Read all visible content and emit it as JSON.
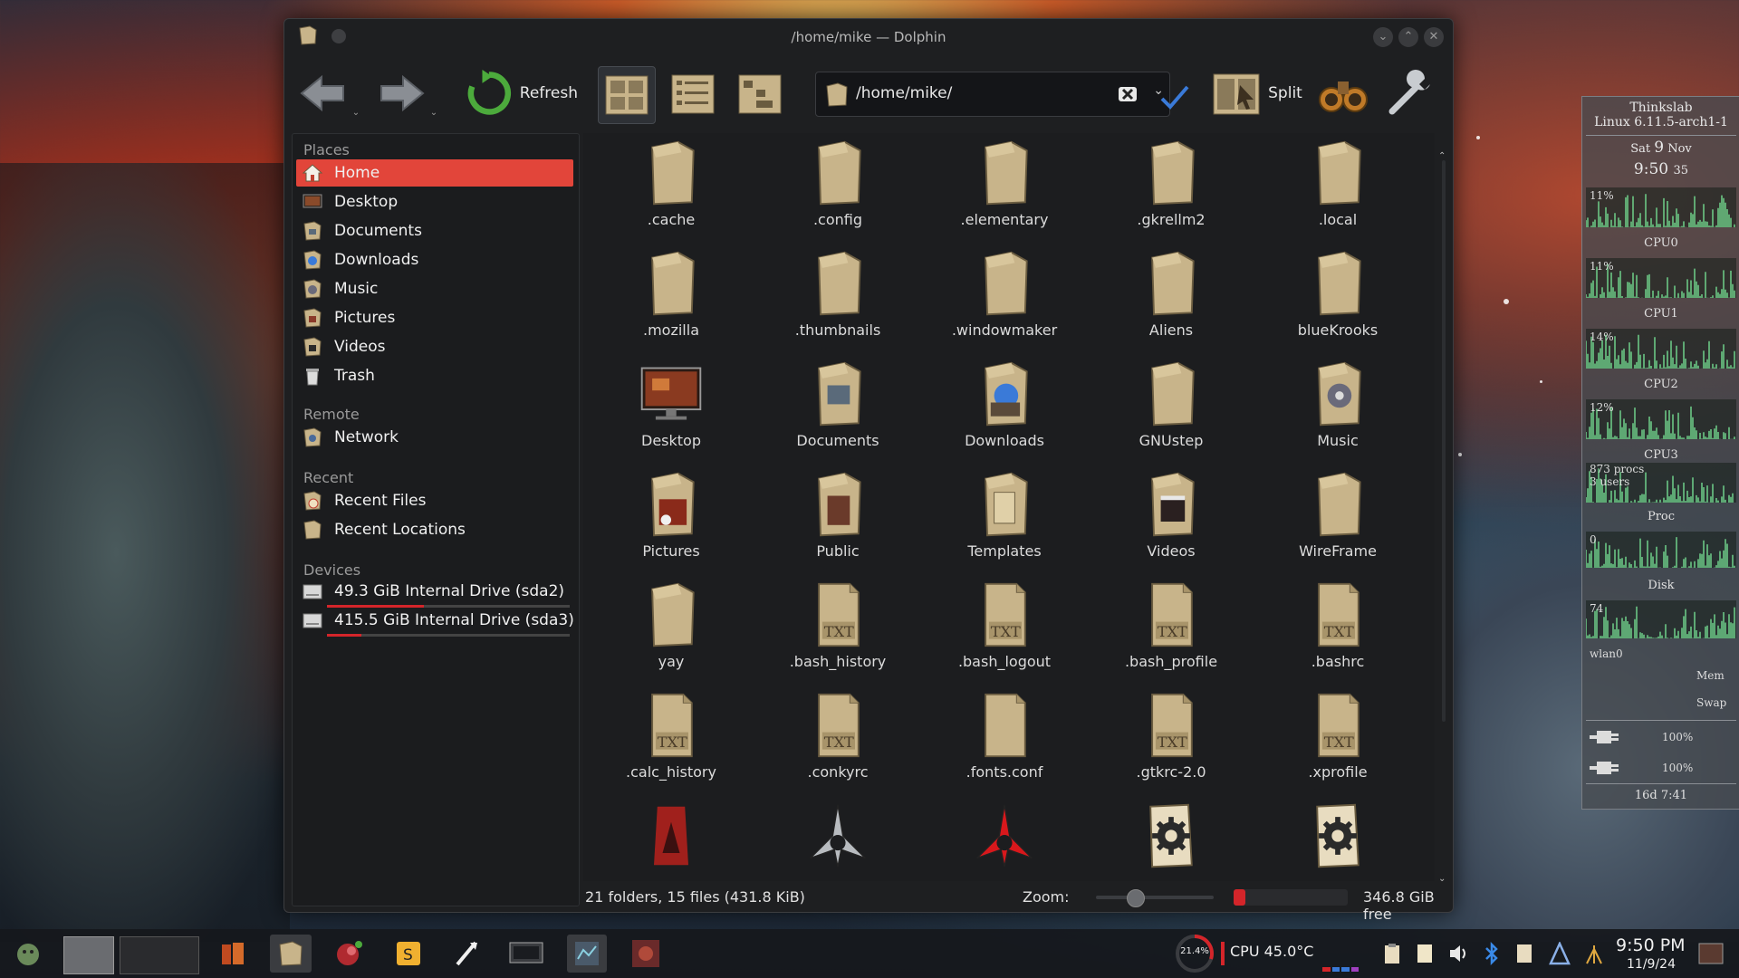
{
  "window": {
    "title": "/home/mike — Dolphin",
    "buttons": [
      "minimize",
      "maximize",
      "close"
    ]
  },
  "toolbar": {
    "refresh_label": "Refresh",
    "split_label": "Split",
    "location_path": "/home/mike/"
  },
  "places": {
    "places_title": "Places",
    "remote_title": "Remote",
    "recent_title": "Recent",
    "devices_title": "Devices",
    "items": {
      "home": "Home",
      "desktop": "Desktop",
      "documents": "Documents",
      "downloads": "Downloads",
      "music": "Music",
      "pictures": "Pictures",
      "videos": "Videos",
      "trash": "Trash",
      "network": "Network",
      "recent_files": "Recent Files",
      "recent_locations": "Recent Locations",
      "drive_sda2": "49.3 GiB Internal Drive (sda2)",
      "drive_sda3": "415.5 GiB Internal Drive (sda3)"
    },
    "drive_sda2_used": 0.4,
    "drive_sda3_used": 0.14
  },
  "files": [
    {
      "name": ".cache",
      "icon": "folder-icon"
    },
    {
      "name": ".config",
      "icon": "folder-icon"
    },
    {
      "name": ".elementary",
      "icon": "folder-icon"
    },
    {
      "name": ".gkrellm2",
      "icon": "folder-icon"
    },
    {
      "name": ".local",
      "icon": "folder-icon"
    },
    {
      "name": ".mozilla",
      "icon": "folder-icon"
    },
    {
      "name": ".thumbnails",
      "icon": "folder-icon"
    },
    {
      "name": ".windowmaker",
      "icon": "folder-icon"
    },
    {
      "name": "Aliens",
      "icon": "folder-icon"
    },
    {
      "name": "blueKrooks",
      "icon": "folder-icon"
    },
    {
      "name": "Desktop",
      "icon": "desktop-folder-icon"
    },
    {
      "name": "Documents",
      "icon": "documents-folder-icon"
    },
    {
      "name": "Downloads",
      "icon": "downloads-folder-icon"
    },
    {
      "name": "GNUstep",
      "icon": "folder-icon"
    },
    {
      "name": "Music",
      "icon": "music-folder-icon"
    },
    {
      "name": "Pictures",
      "icon": "pictures-folder-icon"
    },
    {
      "name": "Public",
      "icon": "public-folder-icon"
    },
    {
      "name": "Templates",
      "icon": "templates-folder-icon"
    },
    {
      "name": "Videos",
      "icon": "videos-folder-icon"
    },
    {
      "name": "WireFrame",
      "icon": "folder-icon"
    },
    {
      "name": "yay",
      "icon": "folder-icon"
    },
    {
      "name": ".bash_history",
      "icon": "text-file-icon"
    },
    {
      "name": ".bash_logout",
      "icon": "text-file-icon"
    },
    {
      "name": ".bash_profile",
      "icon": "text-file-icon"
    },
    {
      "name": ".bashrc",
      "icon": "text-file-icon"
    },
    {
      "name": ".calc_history",
      "icon": "text-file-icon"
    },
    {
      "name": ".conkyrc",
      "icon": "text-file-icon"
    },
    {
      "name": ".fonts.conf",
      "icon": "config-file-icon"
    },
    {
      "name": ".gtkrc-2.0",
      "icon": "text-file-icon"
    },
    {
      "name": ".xprofile",
      "icon": "text-file-icon"
    },
    {
      "name": "",
      "icon": "image-file-icon"
    },
    {
      "name": "",
      "icon": "klingon-emblem-icon"
    },
    {
      "name": "",
      "icon": "klingon-emblem-red-icon"
    },
    {
      "name": "",
      "icon": "gear-file-icon"
    },
    {
      "name": "",
      "icon": "gear-file-icon"
    }
  ],
  "file_text_badge": "TXT",
  "status": {
    "summary": "21 folders, 15 files (431.8 KiB)",
    "zoom_label": "Zoom:",
    "zoom_level": 0.3,
    "free_space": "346.8 GiB free",
    "free_fraction": 0.1
  },
  "conky": {
    "host": "Thinkslab",
    "kernel": "Linux 6.11.5-arch1-1",
    "day": "Sat",
    "date_num": "9",
    "month": "Nov",
    "time": "9:50",
    "seconds": "35",
    "cpu": [
      {
        "label": "CPU0",
        "pct": "11%"
      },
      {
        "label": "CPU1",
        "pct": "11%"
      },
      {
        "label": "CPU2",
        "pct": "14%"
      },
      {
        "label": "CPU3",
        "pct": "12%"
      }
    ],
    "procs": "873 procs",
    "users": "3 users",
    "proc_label": "Proc",
    "disk_value": "0",
    "disk_label": "Disk",
    "net_value": "74",
    "net_label": "wlan0",
    "mem_label": "Mem",
    "swap_label": "Swap",
    "battery1": "100%",
    "battery2": "100%",
    "uptime": "16d  7:41"
  },
  "taskbar": {
    "cpu_ring": "21.4%",
    "cpu_text": "CPU 45.0°C",
    "clock_time": "9:50 PM",
    "clock_date": "11/9/24"
  },
  "colors": {
    "accent": "#e2453a",
    "folder": "#c8b48a",
    "graph": "#6fd08a"
  }
}
